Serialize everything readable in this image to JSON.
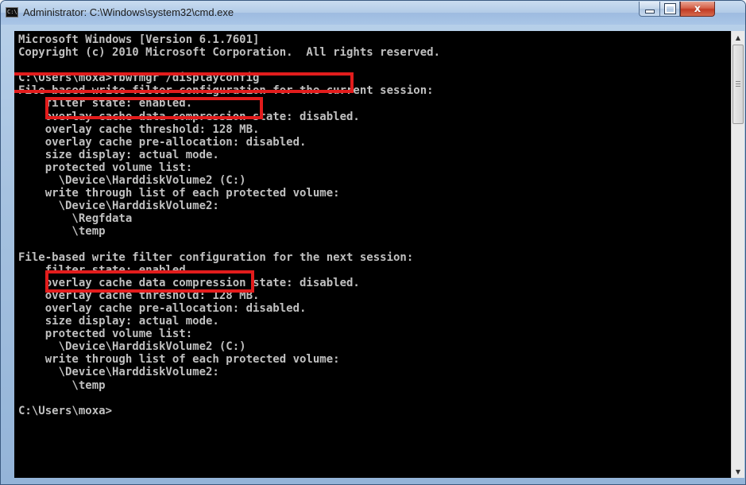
{
  "window": {
    "title": "Administrator: C:\\Windows\\system32\\cmd.exe",
    "app_icon_text": "C:\\",
    "minimize_icon": "minimize-icon",
    "maximize_icon": "maximize-icon",
    "close_icon": "close-icon",
    "close_glyph": "x"
  },
  "console": {
    "lines": [
      "Microsoft Windows [Version 6.1.7601]",
      "Copyright (c) 2010 Microsoft Corporation.  All rights reserved.",
      "",
      "C:\\Users\\moxa>fbwfmgr /displayconfig",
      "File-based write filter configuration for the current session:",
      "    filter state: enabled.",
      "    overlay cache data compression state: disabled.",
      "    overlay cache threshold: 128 MB.",
      "    overlay cache pre-allocation: disabled.",
      "    size display: actual mode.",
      "    protected volume list:",
      "      \\Device\\HarddiskVolume2 (C:)",
      "    write through list of each protected volume:",
      "      \\Device\\HarddiskVolume2:",
      "        \\Regfdata",
      "        \\temp",
      "",
      "File-based write filter configuration for the next session:",
      "    filter state: enabled.",
      "    overlay cache data compression state: disabled.",
      "    overlay cache threshold: 128 MB.",
      "    overlay cache pre-allocation: disabled.",
      "    size display: actual mode.",
      "    protected volume list:",
      "      \\Device\\HarddiskVolume2 (C:)",
      "    write through list of each protected volume:",
      "      \\Device\\HarddiskVolume2:",
      "        \\temp",
      "",
      "C:\\Users\\moxa>"
    ]
  },
  "highlight_color": "#e21c1c",
  "console_text_color": "#c0c0c0",
  "scrollbar": {
    "up_icon": "scroll-up-arrow-icon",
    "down_icon": "scroll-down-arrow-icon"
  }
}
